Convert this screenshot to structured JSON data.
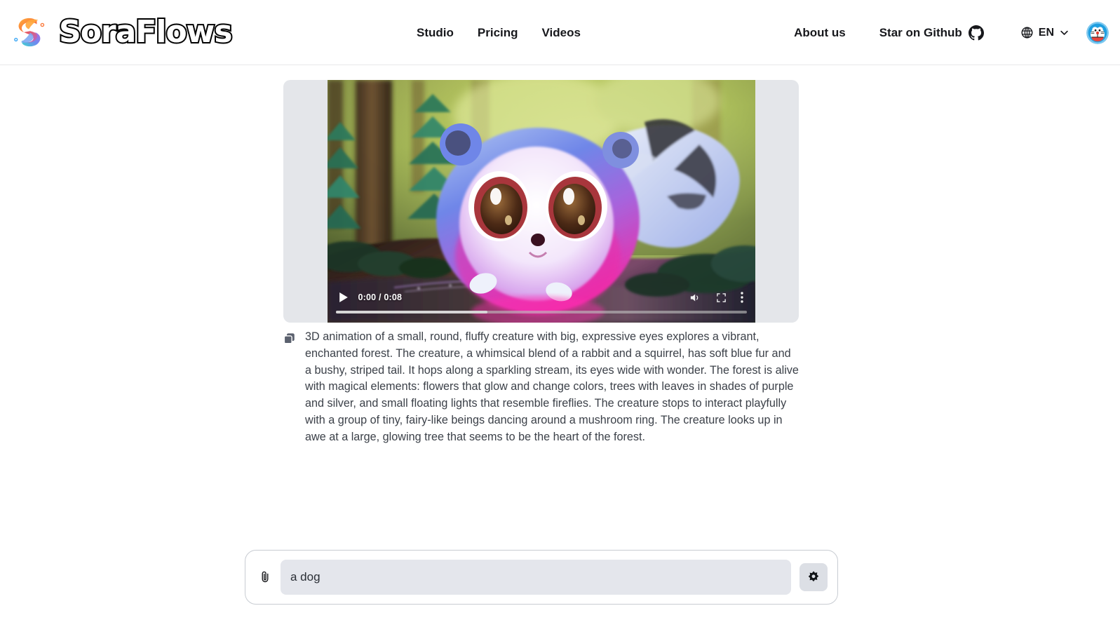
{
  "header": {
    "brand_name": "SoraFlows",
    "logo_icon": "soraflows-s-logo",
    "nav": [
      {
        "label": "Studio",
        "icon": ""
      },
      {
        "label": "Pricing",
        "icon": ""
      },
      {
        "label": "Videos",
        "icon": ""
      }
    ],
    "about_label": "About us",
    "github_label": "Star on Github",
    "github_icon": "github-icon",
    "globe_icon": "globe-icon",
    "language": "EN",
    "chevron_icon": "chevron-down-icon",
    "avatar_icon": "user-avatar"
  },
  "result": {
    "video": {
      "play_icon": "play-icon",
      "time_display": "0:00 / 0:08",
      "current_time": "0:00",
      "duration": "0:08",
      "progress_percent": 37,
      "volume_icon": "volume-icon",
      "fullscreen_icon": "fullscreen-icon",
      "more_icon": "more-options-icon"
    },
    "copy_icon": "copy-icon",
    "prompt": "3D animation of a small, round, fluffy creature with big, expressive eyes explores a vibrant, enchanted forest. The creature, a whimsical blend of a rabbit and a squirrel, has soft blue fur and a bushy, striped tail. It hops along a sparkling stream, its eyes wide with wonder. The forest is alive with magical elements: flowers that glow and change colors, trees with leaves in shades of purple and silver, and small floating lights that resemble fireflies. The creature stops to interact playfully with a group of tiny, fairy-like beings dancing around a mushroom ring. The creature looks up in awe at a large, glowing tree that seems to be the heart of the forest."
  },
  "composer": {
    "attach_icon": "paperclip-icon",
    "input_value": "a dog",
    "input_placeholder": "a dog",
    "settings_icon": "gear-icon"
  },
  "colors": {
    "page_bg": "#ffffff",
    "header_border": "#e8e8ea",
    "video_shell_bg": "#e4e6ea",
    "input_bg": "#e4e6ec",
    "settings_bg": "#dcdfe5",
    "text_primary": "#17181c",
    "text_body": "#3c4149"
  }
}
